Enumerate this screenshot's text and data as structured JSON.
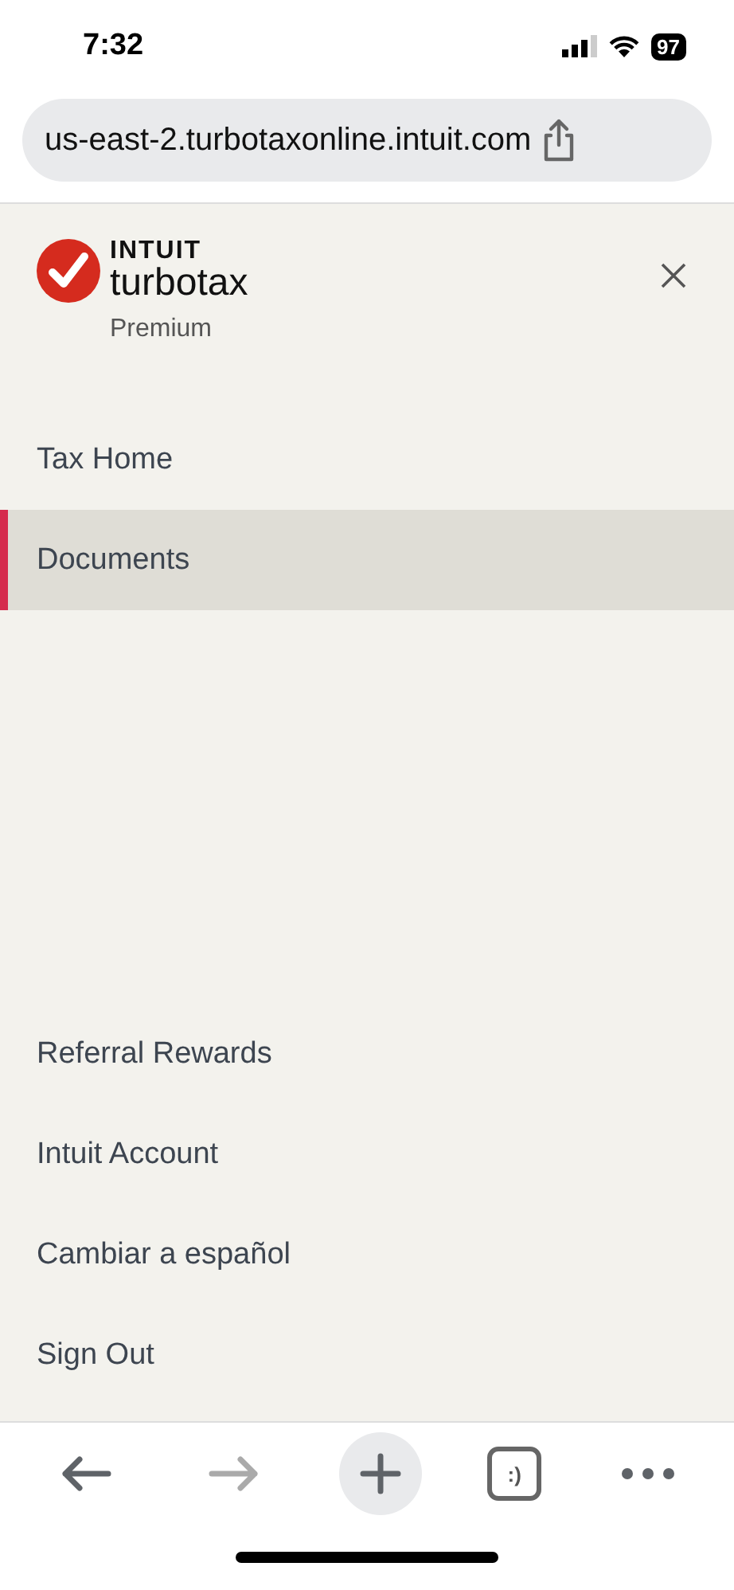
{
  "status_bar": {
    "time": "7:32",
    "battery": "97"
  },
  "address_bar": {
    "url": "us-east-2.turbotaxonline.intuit.com"
  },
  "menu": {
    "brand": {
      "company": "INTUIT",
      "product": "turbotax",
      "edition": "Premium"
    },
    "main_items": [
      {
        "label": "Tax Home",
        "selected": false
      },
      {
        "label": "Documents",
        "selected": true
      }
    ],
    "footer_items": [
      {
        "label": "Referral Rewards",
        "selected": false
      },
      {
        "label": "Intuit Account",
        "selected": false
      },
      {
        "label": "Cambiar a español",
        "selected": false
      },
      {
        "label": "Sign Out",
        "selected": false
      }
    ]
  },
  "toolbar": {
    "back_disabled": false,
    "forward_disabled": true,
    "tabs_label": ":)"
  }
}
